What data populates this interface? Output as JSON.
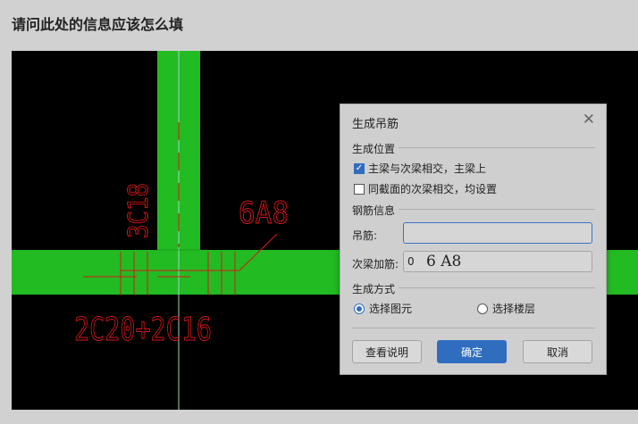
{
  "page": {
    "title": "请问此处的信息应该怎么填"
  },
  "cad": {
    "labels": {
      "col_rebar": "3C18",
      "hanger": "6A8",
      "beam_rebar": "2C20+2C16"
    },
    "colors": {
      "beam": "#22bb22",
      "annotation": "#d81818",
      "background": "#000000"
    }
  },
  "dialog": {
    "title": "生成吊筋",
    "close_icon": "close-icon",
    "section_position": "生成位置",
    "options": [
      {
        "label": "主梁与次梁相交，主梁上",
        "checked": true
      },
      {
        "label": "同截面的次梁相交，均设置",
        "checked": false
      }
    ],
    "section_rebar": "钢筋信息",
    "hanger_label": "吊筋:",
    "hanger_value": "",
    "secondary_label": "次梁加筋:",
    "secondary_value": "0",
    "secondary_handwritten": "6 A8",
    "section_method": "生成方式",
    "method_options": [
      {
        "label": "选择图元",
        "selected": true
      },
      {
        "label": "选择楼层",
        "selected": false
      }
    ],
    "buttons": {
      "help": "查看说明",
      "ok": "确定",
      "cancel": "取消"
    },
    "accent_color": "#2f6dbf"
  }
}
